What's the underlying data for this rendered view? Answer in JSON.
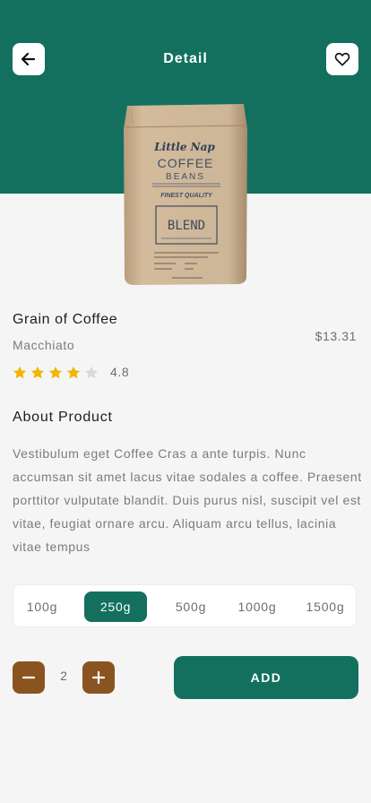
{
  "header": {
    "title": "Detail",
    "back_icon": "arrow-left-icon",
    "favorite_icon": "heart-outline-icon"
  },
  "product": {
    "name": "Grain of Coffee",
    "variant": "Macchiato",
    "price": "$13.31",
    "rating": "4.8",
    "stars_filled": 4,
    "stars_total": 5,
    "image": {
      "brand": "Little Nap",
      "line1": "COFFEE",
      "line2": "BEANS",
      "tagline": "FINEST QUALITY",
      "label": "BLEND"
    }
  },
  "about": {
    "title": "About Product",
    "text": "Vestibulum eget Coffee Cras a ante turpis. Nunc accumsan sit amet lacus vitae sodales a coffee. Praesent porttitor vulputate blandit. Duis purus nisl, suscipit vel est vitae, feugiat ornare arcu. Aliquam arcu tellus, lacinia vitae tempus"
  },
  "sizes": {
    "options": [
      "100g",
      "250g",
      "500g",
      "1000g",
      "1500g"
    ],
    "selected": "250g"
  },
  "quantity": {
    "value": "2",
    "minus_icon": "minus-icon",
    "plus_icon": "plus-icon"
  },
  "actions": {
    "add_label": "ADD"
  },
  "colors": {
    "primary": "#13705f",
    "accent": "#8a5420",
    "star": "#f5b400",
    "star_empty": "#d9d9d9",
    "background": "#f5f5f5"
  }
}
